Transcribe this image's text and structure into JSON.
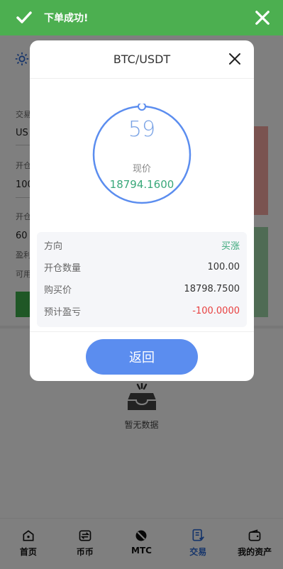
{
  "toast": {
    "message": "下单成功!"
  },
  "background": {
    "labels": [
      "交易",
      "开仓",
      "开仓"
    ],
    "values": [
      "US",
      "100",
      "60"
    ],
    "extra_labels": [
      "盈利",
      "可用"
    ]
  },
  "modal": {
    "title": "BTC/USDT",
    "countdown": "59",
    "current_price_label": "现价",
    "current_price": "18794.1600",
    "rows": [
      {
        "label": "方向",
        "value": "买涨"
      },
      {
        "label": "开仓数量",
        "value": "100.00"
      },
      {
        "label": "购买价",
        "value": "18798.7500"
      },
      {
        "label": "预计盈亏",
        "value": "-100.0000"
      }
    ],
    "back_label": "返回"
  },
  "empty": {
    "text": "暂无数据"
  },
  "tabbar": {
    "tabs": [
      {
        "label": "首页",
        "icon": "home-icon"
      },
      {
        "label": "币币",
        "icon": "exchange-icon"
      },
      {
        "label": "MTC",
        "icon": "mtc-icon"
      },
      {
        "label": "交易",
        "icon": "trade-icon"
      },
      {
        "label": "我的资产",
        "icon": "wallet-icon"
      }
    ],
    "active": "交易"
  },
  "colors": {
    "toast": "#4caf50",
    "accent": "#5b8def",
    "up": "#3aa87a",
    "down": "#e84040"
  }
}
